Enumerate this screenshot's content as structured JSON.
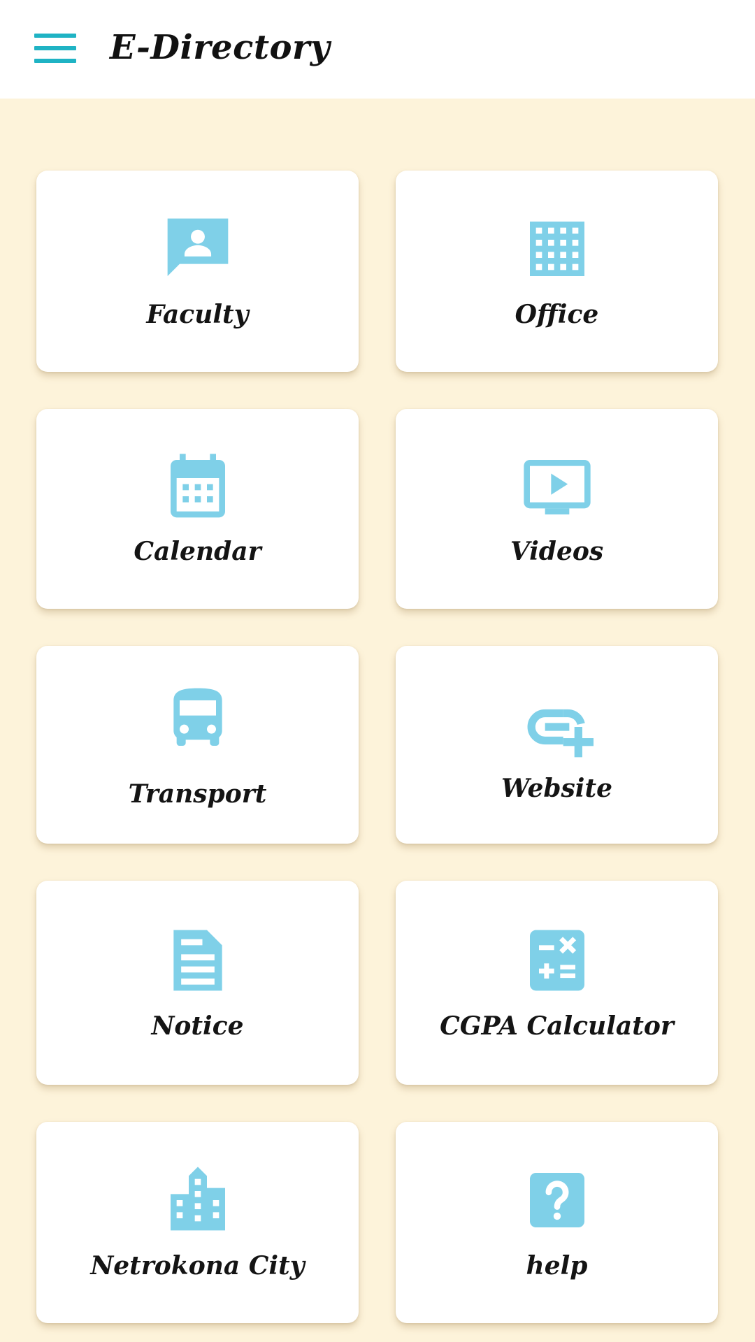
{
  "app_bar": {
    "title": "E-Directory",
    "menu_icon": "hamburger-menu-icon",
    "accent_color": "#1fb3c4"
  },
  "icon_color": "#7fd0e8",
  "background_color": "#fdf3da",
  "cards": [
    {
      "label": "Faculty",
      "icon": "contact-message-icon"
    },
    {
      "label": "Office",
      "icon": "office-building-grid-icon"
    },
    {
      "label": "Calendar",
      "icon": "calendar-icon"
    },
    {
      "label": "Videos",
      "icon": "video-play-icon"
    },
    {
      "label": "Transport",
      "icon": "bus-icon"
    },
    {
      "label": "Website",
      "icon": "add-link-icon"
    },
    {
      "label": "Notice",
      "icon": "document-icon"
    },
    {
      "label": "CGPA Calculator",
      "icon": "calculator-icon"
    },
    {
      "label": "Netrokona City",
      "icon": "city-icon"
    },
    {
      "label": "help",
      "icon": "help-icon"
    }
  ]
}
